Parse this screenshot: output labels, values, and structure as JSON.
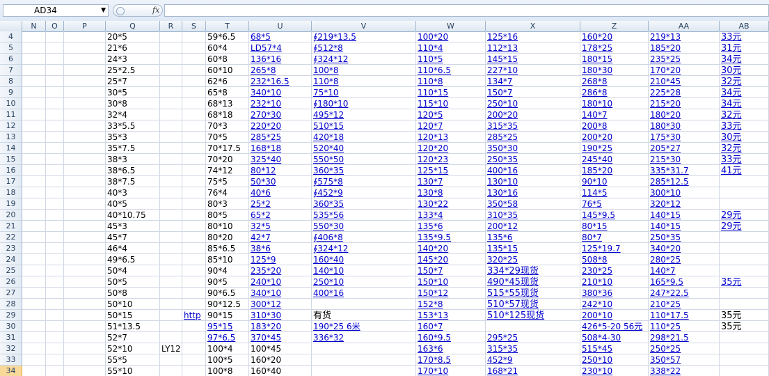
{
  "name_box": "AD34",
  "fx": "fx",
  "columns": [
    "N",
    "O",
    "P",
    "Q",
    "R",
    "S",
    "T",
    "U",
    "V",
    "W",
    "X",
    "Z",
    "AA",
    "AB"
  ],
  "rows": [
    {
      "n": "4",
      "Q": "20*5",
      "T": "59*6.5",
      "U": "68*5",
      "V": "∮219*13.5",
      "W": "100*20",
      "X": "125*16",
      "Z": "160*20",
      "AA": "219*13 ",
      "AB": "33元"
    },
    {
      "n": "5",
      "Q": "21*6",
      "T": "60*4",
      "U": "LD57*4",
      "V": "∮512*8",
      "W": "110*4",
      "X": "112*13",
      "Z": "178*25",
      "AA": "185*20",
      "AB": "31元"
    },
    {
      "n": "6",
      "Q": "24*3",
      "T": "60*8",
      "U": "136*16",
      "V": "∮324*12",
      "W": "110*5",
      "X": "145*15",
      "Z": "180*15",
      "AA": "235*25",
      "AB": "34元"
    },
    {
      "n": "7",
      "Q": "25*2.5",
      "T": "60*10",
      "U": "265*8",
      "V": "100*8",
      "W": "110*6.5",
      "X": "227*10",
      "Z": "180*30",
      "AA": "170*20",
      "AB": "30元"
    },
    {
      "n": "8",
      "Q": "25*7",
      "T": "62*6",
      "U": "232*16.5",
      "V": "110*8",
      "W": "110*8",
      "X": "134*7",
      "Z": "268*8",
      "AA": "210*45",
      "AB": "32元"
    },
    {
      "n": "9",
      "Q": "30*5",
      "T": "65*8",
      "U": "340*10",
      "V": "75*10",
      "W": "110*15",
      "X": "150*7",
      "Z": "286*8",
      "AA": "225*28",
      "AB": "34元"
    },
    {
      "n": "10",
      "Q": "30*8",
      "T": "68*13",
      "U": "232*10",
      "V": "∮180*10",
      "W": "115*10",
      "X": "250*10",
      "Z": "180*10",
      "AA": "215*20",
      "AB": "34元"
    },
    {
      "n": "11",
      "Q": "32*4",
      "T": "68*18",
      "U": "270*30",
      "V": "495*12",
      "W": "120*5",
      "X": "200*20",
      "Z": "140*7",
      "AA": "180*20",
      "AB": "32元"
    },
    {
      "n": "12",
      "Q": "33*5.5",
      "T": "70*3",
      "U": "220*20",
      "V": "510*15",
      "W": "120*7",
      "X": "315*35",
      "Z": "200*8",
      "AA": "180*30",
      "AB": "33元"
    },
    {
      "n": "13",
      "Q": "35*3",
      "T": "70*5",
      "U": "285*25",
      "V": "420*18",
      "W": "120*13",
      "X": "285*25",
      "Z": "200*20",
      "AA": "175*30",
      "AB": "30元"
    },
    {
      "n": "14",
      "Q": "35*7.5",
      "T": "70*17.5",
      "U": "168*18",
      "V": "520*40",
      "W": "120*20",
      "X": "350*30",
      "Z": "190*25",
      "AA": "205*27",
      "AB": "32元"
    },
    {
      "n": "15",
      "Q": "38*3",
      "T": "70*20",
      "U": "325*40",
      "V": "550*50",
      "W": "120*23",
      "X": "250*35",
      "Z": "245*40",
      "AA": "215*30",
      "AB": "33元"
    },
    {
      "n": "16",
      "Q": "38*6.5",
      "T": "74*12",
      "U": "80*12",
      "V": "360*35",
      "W": "125*15",
      "X": "400*16",
      "Z": "185*20",
      "AA": "335*31.7",
      "AB": "41元"
    },
    {
      "n": "17",
      "Q": "38*7.5",
      "T": "75*5",
      "U": "50*30",
      "V": "∮575*8",
      "W": "130*7",
      "X": "130*10",
      "Z": "90*10",
      "AA": "285*12.5",
      "AB": ""
    },
    {
      "n": "18",
      "Q": "40*3",
      "T": "76*4",
      "U": "40*6",
      "V": "∮452*9",
      "W": "130*8",
      "X": "130*16",
      "Z": "114*5",
      "AA": "300*10",
      "AB": ""
    },
    {
      "n": "19",
      "Q": "40*5",
      "T": "80*3",
      "U": "25*2",
      "V": "360*35",
      "W": "130*22",
      "X": "350*58",
      "Z": "76*5",
      "AA": "320*12",
      "AB": ""
    },
    {
      "n": "20",
      "Q": "40*10.75",
      "T": "80*5",
      "U": "65*2",
      "V": "535*56",
      "W": "133*4",
      "X": "310*35",
      "Z": "145*9.5",
      "AA": "140*15",
      "AB": "29元"
    },
    {
      "n": "21",
      "Q": "45*3",
      "T": "80*10",
      "U": "32*5",
      "V": "550*30",
      "W": "135*6",
      "X": "200*12",
      "Z": "80*15",
      "AA": "140*15",
      "AB": "29元"
    },
    {
      "n": "22",
      "Q": "45*7",
      "T": "80*20",
      "U": "42*7",
      "V": "∮406*8",
      "W": "135*9.5",
      "X": "135*6",
      "Z": "80*7",
      "AA": "250*35",
      "AB": ""
    },
    {
      "n": "23",
      "Q": "46*4",
      "T": "85*6.5",
      "U": "38*6",
      "V": "∮324*12",
      "W": "140*20",
      "X": "135*15",
      "Z": "125*19.7",
      "AA": "340*20",
      "AB": ""
    },
    {
      "n": "24",
      "Q": "49*6.5",
      "T": "85*10",
      "U": "125*9",
      "V": "160*40",
      "W": "145*20",
      "X": "320*25",
      "Z": "508*8",
      "AA": "280*25",
      "AB": ""
    },
    {
      "n": "25",
      "Q": "50*4",
      "T": "90*4",
      "U": "235*20",
      "V": "140*10",
      "W": "150*7",
      "X": "334*29现货",
      "Z": "230*25",
      "AA": "140*7",
      "AB": ""
    },
    {
      "n": "26",
      "Q": "50*5",
      "T": "90*5",
      "U": "240*10",
      "V": "250*10",
      "W": "150*10",
      "X": "490*45现货",
      "Z": "210*10",
      "AA": "165*9.5",
      "AB": "35元"
    },
    {
      "n": "27",
      "Q": "50*8",
      "T": "90*6.5",
      "U": "340*10",
      "V": "400*16",
      "W": "150*12",
      "X": "515*55现货",
      "Z": "380*36",
      "AA": "247*22.5",
      "AB": ""
    },
    {
      "n": "28",
      "Q": "50*10",
      "T": "90*12.5",
      "U": "300*12",
      "V": "",
      "W": "152*8",
      "X": "510*57现货",
      "Z": "242*10",
      "AA": "210*25",
      "AB": ""
    },
    {
      "n": "29",
      "Q": "50*15",
      "S": "http",
      "T": "90*15",
      "U": "310*30",
      "V": "有货",
      "W": "153*13",
      "X": "510*125现货",
      "Z": "200*10",
      "AA": "110*17.5",
      "AB": "35元"
    },
    {
      "n": "30",
      "Q": "51*13.5",
      "T": "95*15",
      "U": "183*20",
      "V": "190*25 6米 ",
      "W": "160*7",
      "X": "",
      "Z": "426*5-20   56元",
      "AA": "110*25",
      "AB": "35元"
    },
    {
      "n": "31",
      "Q": "52*7",
      "T": "97*6.5",
      "U": "370*45",
      "V": "336*32",
      "W": "160*9.5",
      "X": "295*25",
      "Z": "508*4-30",
      "AA": "298*21.5",
      "AB": ""
    },
    {
      "n": "32",
      "Q": "52*10",
      "R": "LY12",
      "T": "100*4",
      "U": "100*45",
      "V": "",
      "W": "163*6",
      "X": "315*35",
      "Z": "515*45",
      "AA": "250*25",
      "AB": ""
    },
    {
      "n": "33",
      "Q": "55*5",
      "T": "100*5",
      "U": "160*20",
      "V": "",
      "W": "170*8.5",
      "X": "452*9",
      "Z": "250*10",
      "AA": "350*57",
      "AB": ""
    },
    {
      "n": "34",
      "Q": "55*10",
      "T": "100*8",
      "U": "160*40",
      "V": "",
      "W": "170*10",
      "X": "168*21",
      "Z": "230*10",
      "AA": "338*22",
      "AB": ""
    }
  ]
}
